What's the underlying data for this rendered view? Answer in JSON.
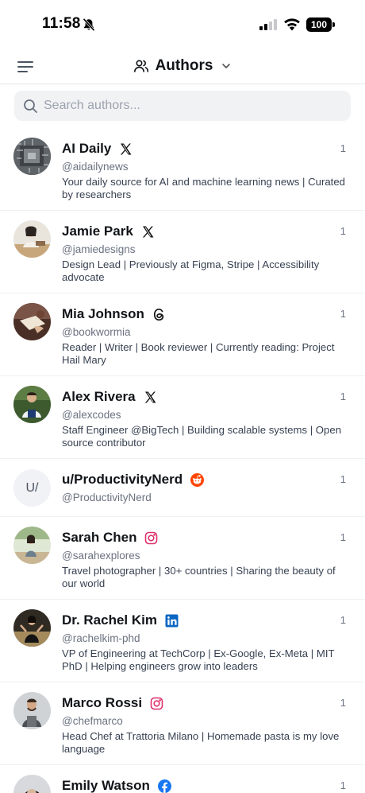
{
  "status": {
    "time": "11:58",
    "battery": "100"
  },
  "header": {
    "title": "Authors"
  },
  "search": {
    "placeholder": "Search authors..."
  },
  "authors": [
    {
      "name": "AI Daily",
      "platform": "x-icon",
      "handle": "@aidailynews",
      "bio": "Your daily source for AI and machine learning news | Curated by researchers",
      "count": "1",
      "avatar": "avatar-circuit"
    },
    {
      "name": "Jamie Park",
      "platform": "x-icon",
      "handle": "@jamiedesigns",
      "bio": "Design Lead | Previously at Figma, Stripe | Accessibility advocate",
      "count": "1",
      "avatar": "avatar-photo"
    },
    {
      "name": "Mia Johnson",
      "platform": "threads-icon",
      "handle": "@bookwormia",
      "bio": "Reader | Writer | Book reviewer | Currently reading: Project Hail Mary",
      "count": "1",
      "avatar": "avatar-photo"
    },
    {
      "name": "Alex Rivera",
      "platform": "x-icon",
      "handle": "@alexcodes",
      "bio": "Staff Engineer @BigTech | Building scalable systems | Open source contributor",
      "count": "1",
      "avatar": "avatar-photo"
    },
    {
      "name": "u/ProductivityNerd",
      "platform": "reddit-icon",
      "handle": "@ProductivityNerd",
      "bio": "",
      "count": "1",
      "avatar_initials": "U/"
    },
    {
      "name": "Sarah Chen",
      "platform": "instagram-icon",
      "handle": "@sarahexplores",
      "bio": "Travel photographer | 30+ countries | Sharing the beauty of our world",
      "count": "1",
      "avatar": "avatar-photo"
    },
    {
      "name": "Dr. Rachel Kim",
      "platform": "linkedin-icon",
      "handle": "@rachelkim-phd",
      "bio": "VP of Engineering at TechCorp | Ex-Google, Ex-Meta | MIT PhD | Helping engineers grow into leaders",
      "count": "1",
      "avatar": "avatar-photo"
    },
    {
      "name": "Marco Rossi",
      "platform": "instagram-icon",
      "handle": "@chefmarco",
      "bio": "Head Chef at Trattoria Milano | Homemade pasta is my love language",
      "count": "1",
      "avatar": "avatar-photo"
    },
    {
      "name": "Emily Watson",
      "platform": "facebook-icon",
      "handle": "",
      "bio": "",
      "count": "1",
      "avatar": "avatar-photo"
    }
  ],
  "colors": {
    "accent_reddit": "#ff4500",
    "instagram": "#e1306c",
    "linkedin": "#0a66c2",
    "facebook": "#1877f2"
  }
}
